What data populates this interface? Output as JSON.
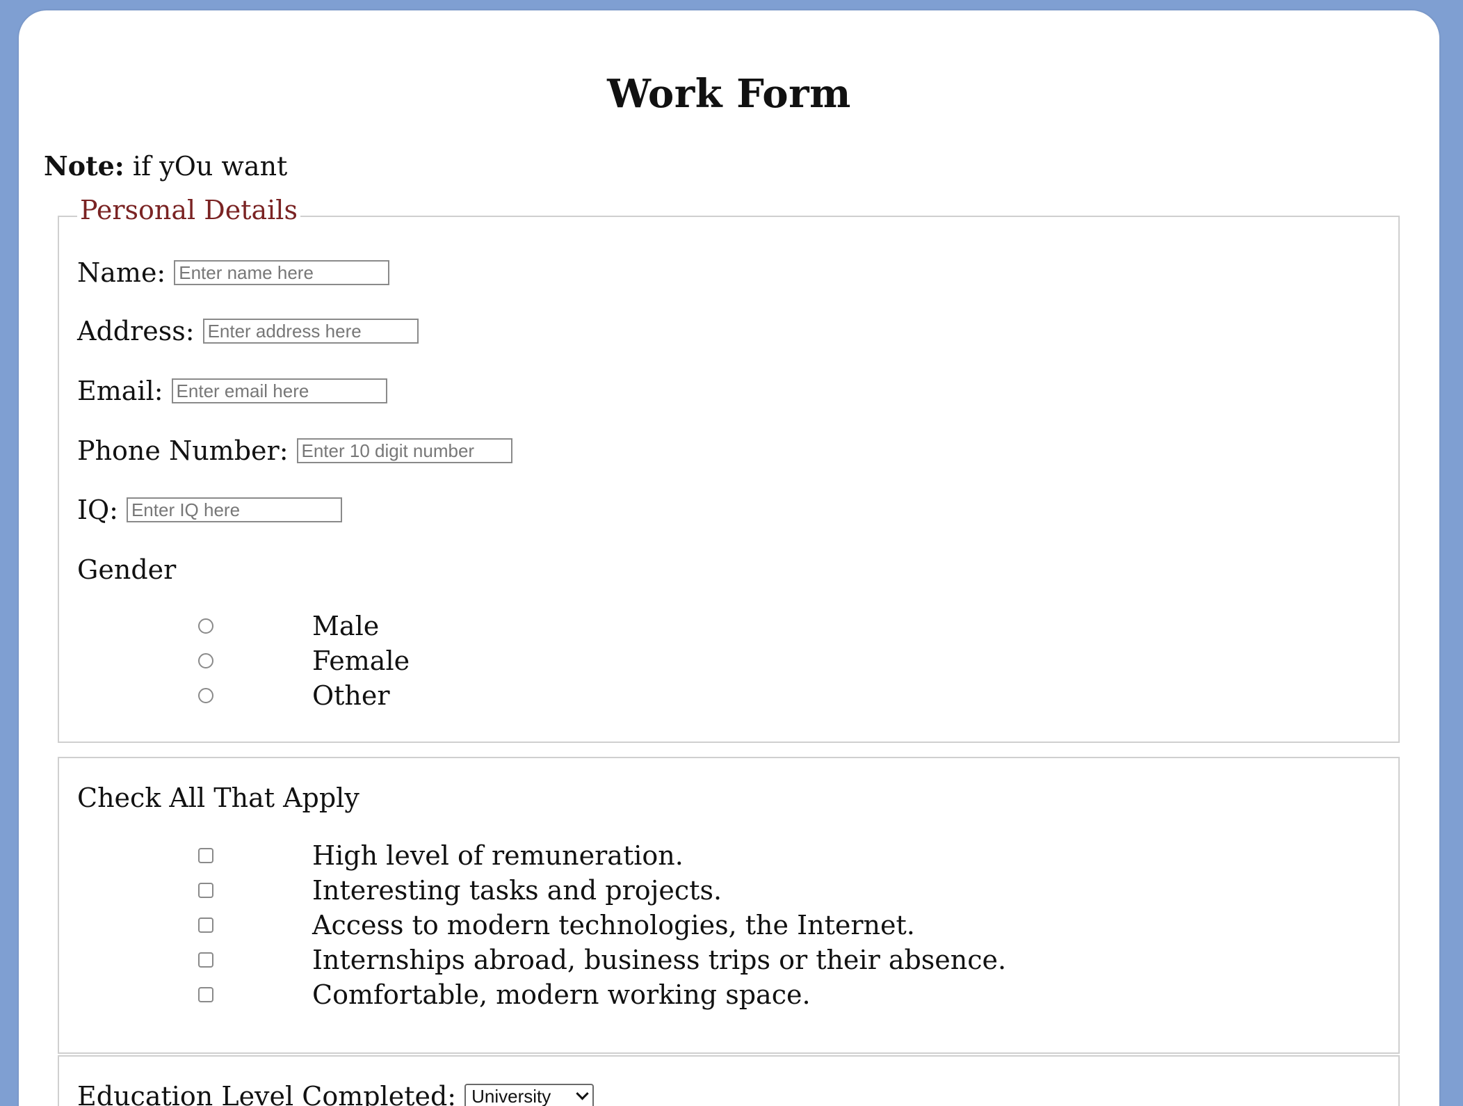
{
  "page": {
    "title": "Work Form",
    "note_label": "Note:",
    "note_text": " if yOu want"
  },
  "personal": {
    "legend": "Personal Details",
    "fields": [
      {
        "label": "Name:",
        "placeholder": "Enter name here",
        "value": ""
      },
      {
        "label": "Address:",
        "placeholder": "Enter address here",
        "value": ""
      },
      {
        "label": "Email:",
        "placeholder": "Enter email here",
        "value": ""
      },
      {
        "label": "Phone Number:",
        "placeholder": "Enter 10 digit number",
        "value": ""
      },
      {
        "label": "IQ:",
        "placeholder": "Enter IQ here",
        "value": ""
      }
    ],
    "gender": {
      "label": "Gender",
      "options": [
        "Male",
        "Female",
        "Other"
      ]
    }
  },
  "checks": {
    "label": "Check All That Apply",
    "options": [
      "High level of remuneration.",
      "Interesting tasks and projects.",
      "Access to modern technologies, the Internet.",
      "Internships abroad, business trips or their absence.",
      "Comfortable, modern working space."
    ]
  },
  "education": {
    "label": "Education Level Completed:",
    "selected": "University"
  },
  "colors": {
    "page_background": "#7f9fd2",
    "legend_text": "#7a2323"
  },
  "icons": {
    "select_arrow": "chevron-down-icon"
  }
}
